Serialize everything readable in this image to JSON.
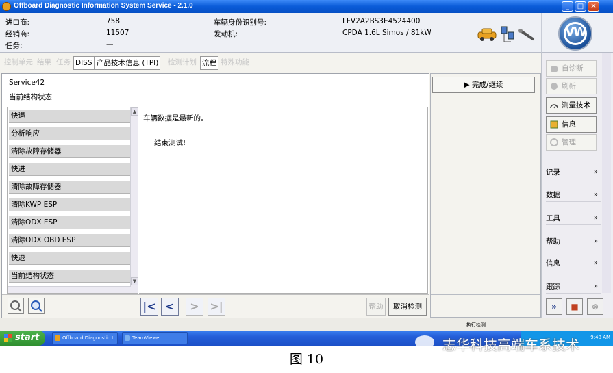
{
  "window": {
    "title": "Offboard Diagnostic Information System Service - 2.1.0",
    "minimize": "_",
    "maximize": "□",
    "close": "✕"
  },
  "header": {
    "importer_label": "进口商:",
    "importer_value": "758",
    "dealer_label": "经销商:",
    "dealer_value": "11507",
    "task_label": "任务:",
    "task_value": "—",
    "vin_label": "车辆身份识别号:",
    "vin_value": "LFV2A2BS3E4524400",
    "engine_label": "发动机:",
    "engine_value": "CPDA 1.6L Simos / 81kW",
    "logo_text": "VW"
  },
  "tabs": [
    {
      "label": "控制单元",
      "active": false
    },
    {
      "label": "结果",
      "active": false
    },
    {
      "label": "任务",
      "active": false
    },
    {
      "label": "DISS",
      "active": true
    },
    {
      "label": "产品技术信息 (TPI)",
      "active": true
    },
    {
      "label": "检测计划",
      "active": false
    },
    {
      "label": "流程",
      "active": true
    },
    {
      "label": "特殊功能",
      "active": false
    }
  ],
  "main": {
    "service_title": "Service42",
    "service_subtitle": "当前结构状态",
    "steps": [
      "快退",
      "分析响应",
      "清除故障存储器",
      "快进",
      "清除故障存储器",
      "清除KWP ESP",
      "清除ODX ESP",
      "清除ODX OBD ESP",
      "快退",
      "当前结构状态"
    ],
    "content_line1": "车辆数据是最新的。",
    "content_line2": "结束测试!",
    "help_label": "帮助",
    "cancel_label": "取消检测"
  },
  "actions": {
    "continue_label": "▶ 完成/继续"
  },
  "right": {
    "buttons": [
      {
        "label": "自诊断",
        "enabled": false
      },
      {
        "label": "刷新",
        "enabled": false
      },
      {
        "label": "测量技术",
        "enabled": true
      },
      {
        "label": "信息",
        "enabled": true
      },
      {
        "label": "管理",
        "enabled": false
      }
    ],
    "sections": [
      "记录",
      "数据",
      "工具",
      "帮助",
      "信息",
      "跟踪"
    ],
    "chevron": "»"
  },
  "statusbar": {
    "text": "执行检测"
  },
  "taskbar": {
    "start": "start",
    "items": [
      "Offboard Diagnostic I...",
      "TeamViewer"
    ],
    "time": "9:48 AM"
  },
  "watermark": "志华科技高端车系技术",
  "caption": "图 10"
}
